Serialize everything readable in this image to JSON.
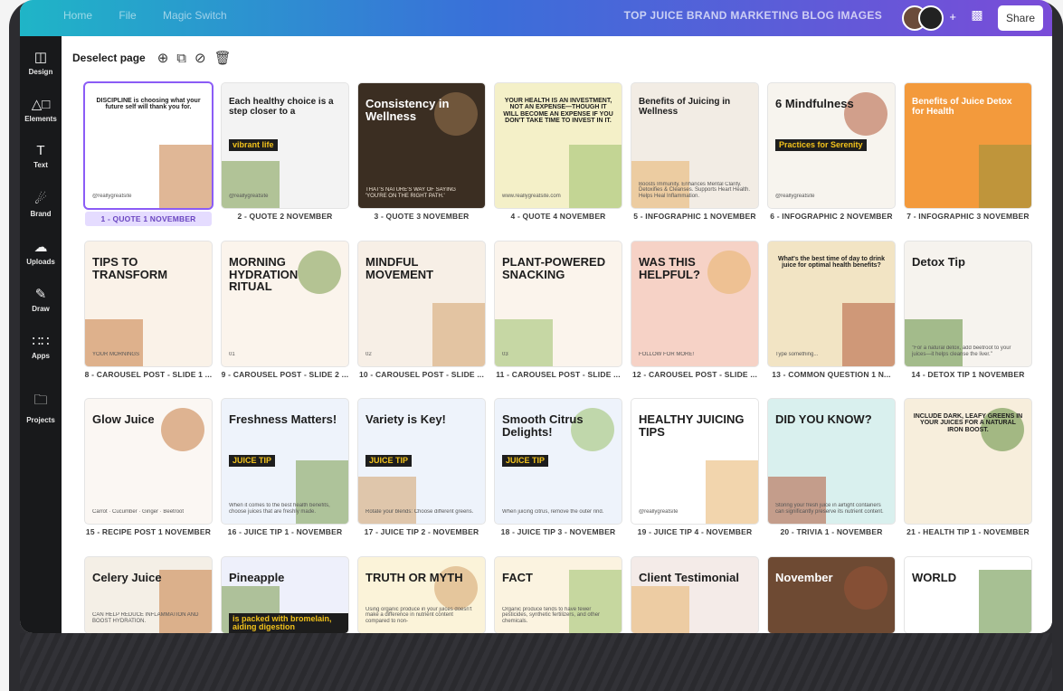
{
  "topbar": {
    "menu": [
      "Home",
      "File",
      "Magic Switch"
    ],
    "title": "TOP JUICE BRAND MARKETING BLOG IMAGES",
    "share_label": "Share"
  },
  "sidebar": {
    "items": [
      {
        "label": "Design",
        "icon": "layout-icon"
      },
      {
        "label": "Elements",
        "icon": "shapes-icon"
      },
      {
        "label": "Text",
        "icon": "text-icon"
      },
      {
        "label": "Brand",
        "icon": "brand-icon"
      },
      {
        "label": "Uploads",
        "icon": "cloud-upload-icon"
      },
      {
        "label": "Draw",
        "icon": "pen-icon"
      },
      {
        "label": "Apps",
        "icon": "apps-grid-icon"
      },
      {
        "label": "Projects",
        "icon": "folder-icon"
      }
    ]
  },
  "toolbar": {
    "deselect_label": "Deselect page"
  },
  "pages": [
    {
      "label": "1 - QUOTE 1 NOVEMBER",
      "selected": true,
      "bg": "#ffffff",
      "text": "DISCIPLINE is choosing what your future self will thank you for.",
      "sub": "@reallygreatsite"
    },
    {
      "label": "2 - QUOTE 2 NOVEMBER",
      "bg": "#f3f3f3",
      "text": "Each healthy choice is a step closer to a",
      "accent": "vibrant life",
      "sub": "@reallygreatsite"
    },
    {
      "label": "3 - QUOTE 3 NOVEMBER",
      "bg": "#3b2e22",
      "text": "Consistency in Wellness",
      "sub": "THAT'S NATURE'S WAY OF SAYING 'YOU'RE ON THE RIGHT PATH.'"
    },
    {
      "label": "4 - QUOTE 4 NOVEMBER",
      "bg": "#f4f0c8",
      "text": "YOUR HEALTH IS AN INVESTMENT, NOT AN EXPENSE—THOUGH IT WILL BECOME AN EXPENSE IF YOU DON'T TAKE TIME TO INVEST IN IT.",
      "sub": "www.reallygreatsite.com"
    },
    {
      "label": "5 - INFOGRAPHIC 1 NOVEMBER",
      "bg": "#f2ece4",
      "text": "Benefits of Juicing in Wellness",
      "sub": "Boosts Immunity. Enhances Mental Clarity. Detoxifies & Cleanses. Supports Heart Health. Helps Heal Inflammation."
    },
    {
      "label": "6 - INFOGRAPHIC 2 NOVEMBER",
      "bg": "#f7f4ee",
      "text": "6 Mindfulness",
      "accent": "Practices for Serenity",
      "sub": "@reallygreatsite"
    },
    {
      "label": "7 - INFOGRAPHIC 3 NOVEMBER",
      "bg": "#f39a3c",
      "text": "Benefits of Juice Detox for Health"
    },
    {
      "label": "8 - CAROUSEL POST - SLIDE 1 ...",
      "bg": "#faf2e8",
      "text": "TIPS TO TRANSFORM",
      "sub": "YOUR MORNINGS"
    },
    {
      "label": "9 - CAROUSEL POST - SLIDE 2 ...",
      "bg": "#fbf4ec",
      "text": "MORNING HYDRATION RITUAL",
      "sub": "01"
    },
    {
      "label": "10 - CAROUSEL POST - SLIDE ...",
      "bg": "#f7efe6",
      "text": "MINDFUL MOVEMENT",
      "sub": "02"
    },
    {
      "label": "11 - CAROUSEL POST - SLIDE ...",
      "bg": "#fbf4ec",
      "text": "PLANT-POWERED SNACKING",
      "sub": "03"
    },
    {
      "label": "12 - CAROUSEL POST - SLIDE ...",
      "bg": "#f6d2c6",
      "text": "WAS THIS HELPFUL?",
      "sub": "FOLLOW FOR MORE!"
    },
    {
      "label": "13 - COMMON QUESTION 1 N...",
      "bg": "#f2e4c4",
      "text": "What's the best time of day to drink juice for optimal health benefits?",
      "sub": "Type something..."
    },
    {
      "label": "14 - DETOX TIP 1 NOVEMBER",
      "bg": "#f6f3ee",
      "text": "Detox Tip",
      "sub": "\"For a natural detox, add beetroot to your juices—it helps cleanse the liver.\""
    },
    {
      "label": "15 - RECIPE POST 1 NOVEMBER",
      "bg": "#fbf7f3",
      "text": "Glow Juice",
      "sub": "Carrot · Cucumber · Ginger · Beetroot"
    },
    {
      "label": "16 - JUICE TIP 1 - NOVEMBER",
      "bg": "#eef3fb",
      "text": "Freshness Matters!",
      "accent": "JUICE TIP",
      "sub": "When it comes to the best health benefits, choose juices that are freshly made."
    },
    {
      "label": "17 - JUICE TIP 2 - NOVEMBER",
      "bg": "#eef3fb",
      "text": "Variety is Key!",
      "accent": "JUICE TIP",
      "sub": "Rotate your blends: Choose different greens."
    },
    {
      "label": "18 - JUICE TIP 3 - NOVEMBER",
      "bg": "#eef3fb",
      "text": "Smooth Citrus Delights!",
      "accent": "JUICE TIP",
      "sub": "When juicing citrus, remove the outer rind."
    },
    {
      "label": "19 - JUICE TIP 4 - NOVEMBER",
      "bg": "#ffffff",
      "text": "HEALTHY JUICING TIPS",
      "sub": "@reallygreatsite"
    },
    {
      "label": "20 - TRIVIA 1 - NOVEMBER",
      "bg": "#d9f0ee",
      "text": "DID YOU KNOW?",
      "sub": "Storing your fresh juice in airtight containers can significantly preserve its nutrient content."
    },
    {
      "label": "21 - HEALTH TIP 1 - NOVEMBER",
      "bg": "#f7eedc",
      "text": "INCLUDE DARK, LEAFY GREENS IN YOUR JUICES FOR A NATURAL IRON BOOST."
    },
    {
      "label": "",
      "bg": "#f4efe6",
      "text": "Celery Juice",
      "sub": "CAN HELP REDUCE INFLAMMATION AND BOOST HYDRATION."
    },
    {
      "label": "",
      "bg": "#eef0fb",
      "text": "Pineapple",
      "accent": "is packed with bromelain, aiding digestion"
    },
    {
      "label": "",
      "bg": "#fbf3d9",
      "text": "TRUTH OR MYTH",
      "sub": "Using organic produce in your juices doesn't make a difference in nutrient content compared to non-"
    },
    {
      "label": "",
      "bg": "#fbf3e0",
      "text": "FACT",
      "sub": "Organic produce tends to have fewer pesticides, synthetic fertilizers, and other chemicals."
    },
    {
      "label": "",
      "bg": "#f4ebe8",
      "text": "Client Testimonial"
    },
    {
      "label": "",
      "bg": "#6e4a33",
      "text": "November"
    },
    {
      "label": "",
      "bg": "#ffffff",
      "text": "WORLD"
    }
  ]
}
